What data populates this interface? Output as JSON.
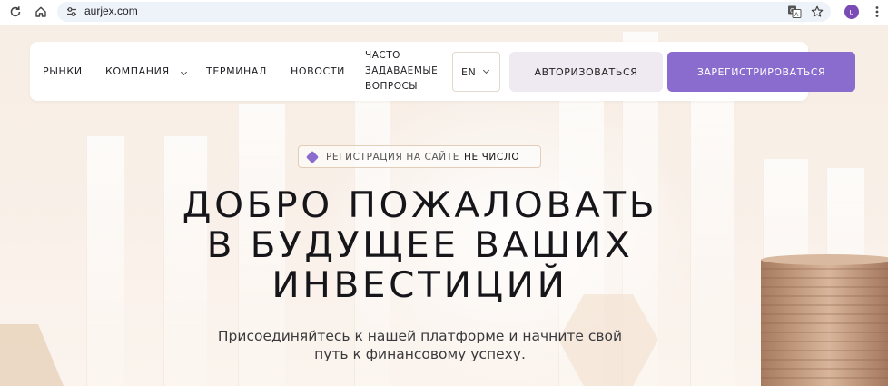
{
  "browser": {
    "url": "aurjex.com",
    "profile_initial": "u"
  },
  "nav": {
    "markets": "РЫНКИ",
    "company": "КОМПАНИЯ",
    "terminal": "ТЕРМИНАЛ",
    "news": "НОВОСТИ",
    "faq_line1": "ЧАСТО",
    "faq_line2": "ЗАДАВАЕМЫЕ",
    "faq_line3": "ВОПРОСЫ",
    "language": "EN",
    "login": "АВТОРИЗОВАТЬСЯ",
    "register": "ЗАРЕГИСТРИРОВАТЬСЯ"
  },
  "hero": {
    "badge_prefix": "РЕГИСТРАЦИЯ НА САЙТЕ",
    "badge_suffix": "НЕ ЧИСЛО",
    "title_line1": "ДОБРО ПОЖАЛОВАТЬ",
    "title_line2": "В БУДУЩЕЕ ВАШИХ",
    "title_line3": "ИНВЕСТИЦИЙ",
    "subtitle_line1": "Присоединяйтесь к нашей платформе и начните свой",
    "subtitle_line2": "путь к финансовому успеху."
  },
  "colors": {
    "accent": "#8a6ccf",
    "login_bg": "#efe9f2",
    "page_bg": "#f7eee6",
    "title": "#16161a"
  },
  "icons": {
    "reload": "reload-icon",
    "home": "home-icon",
    "site_info": "site-settings-icon",
    "translate": "translate-icon",
    "bookmark": "star-icon",
    "menu": "kebab-menu-icon"
  }
}
